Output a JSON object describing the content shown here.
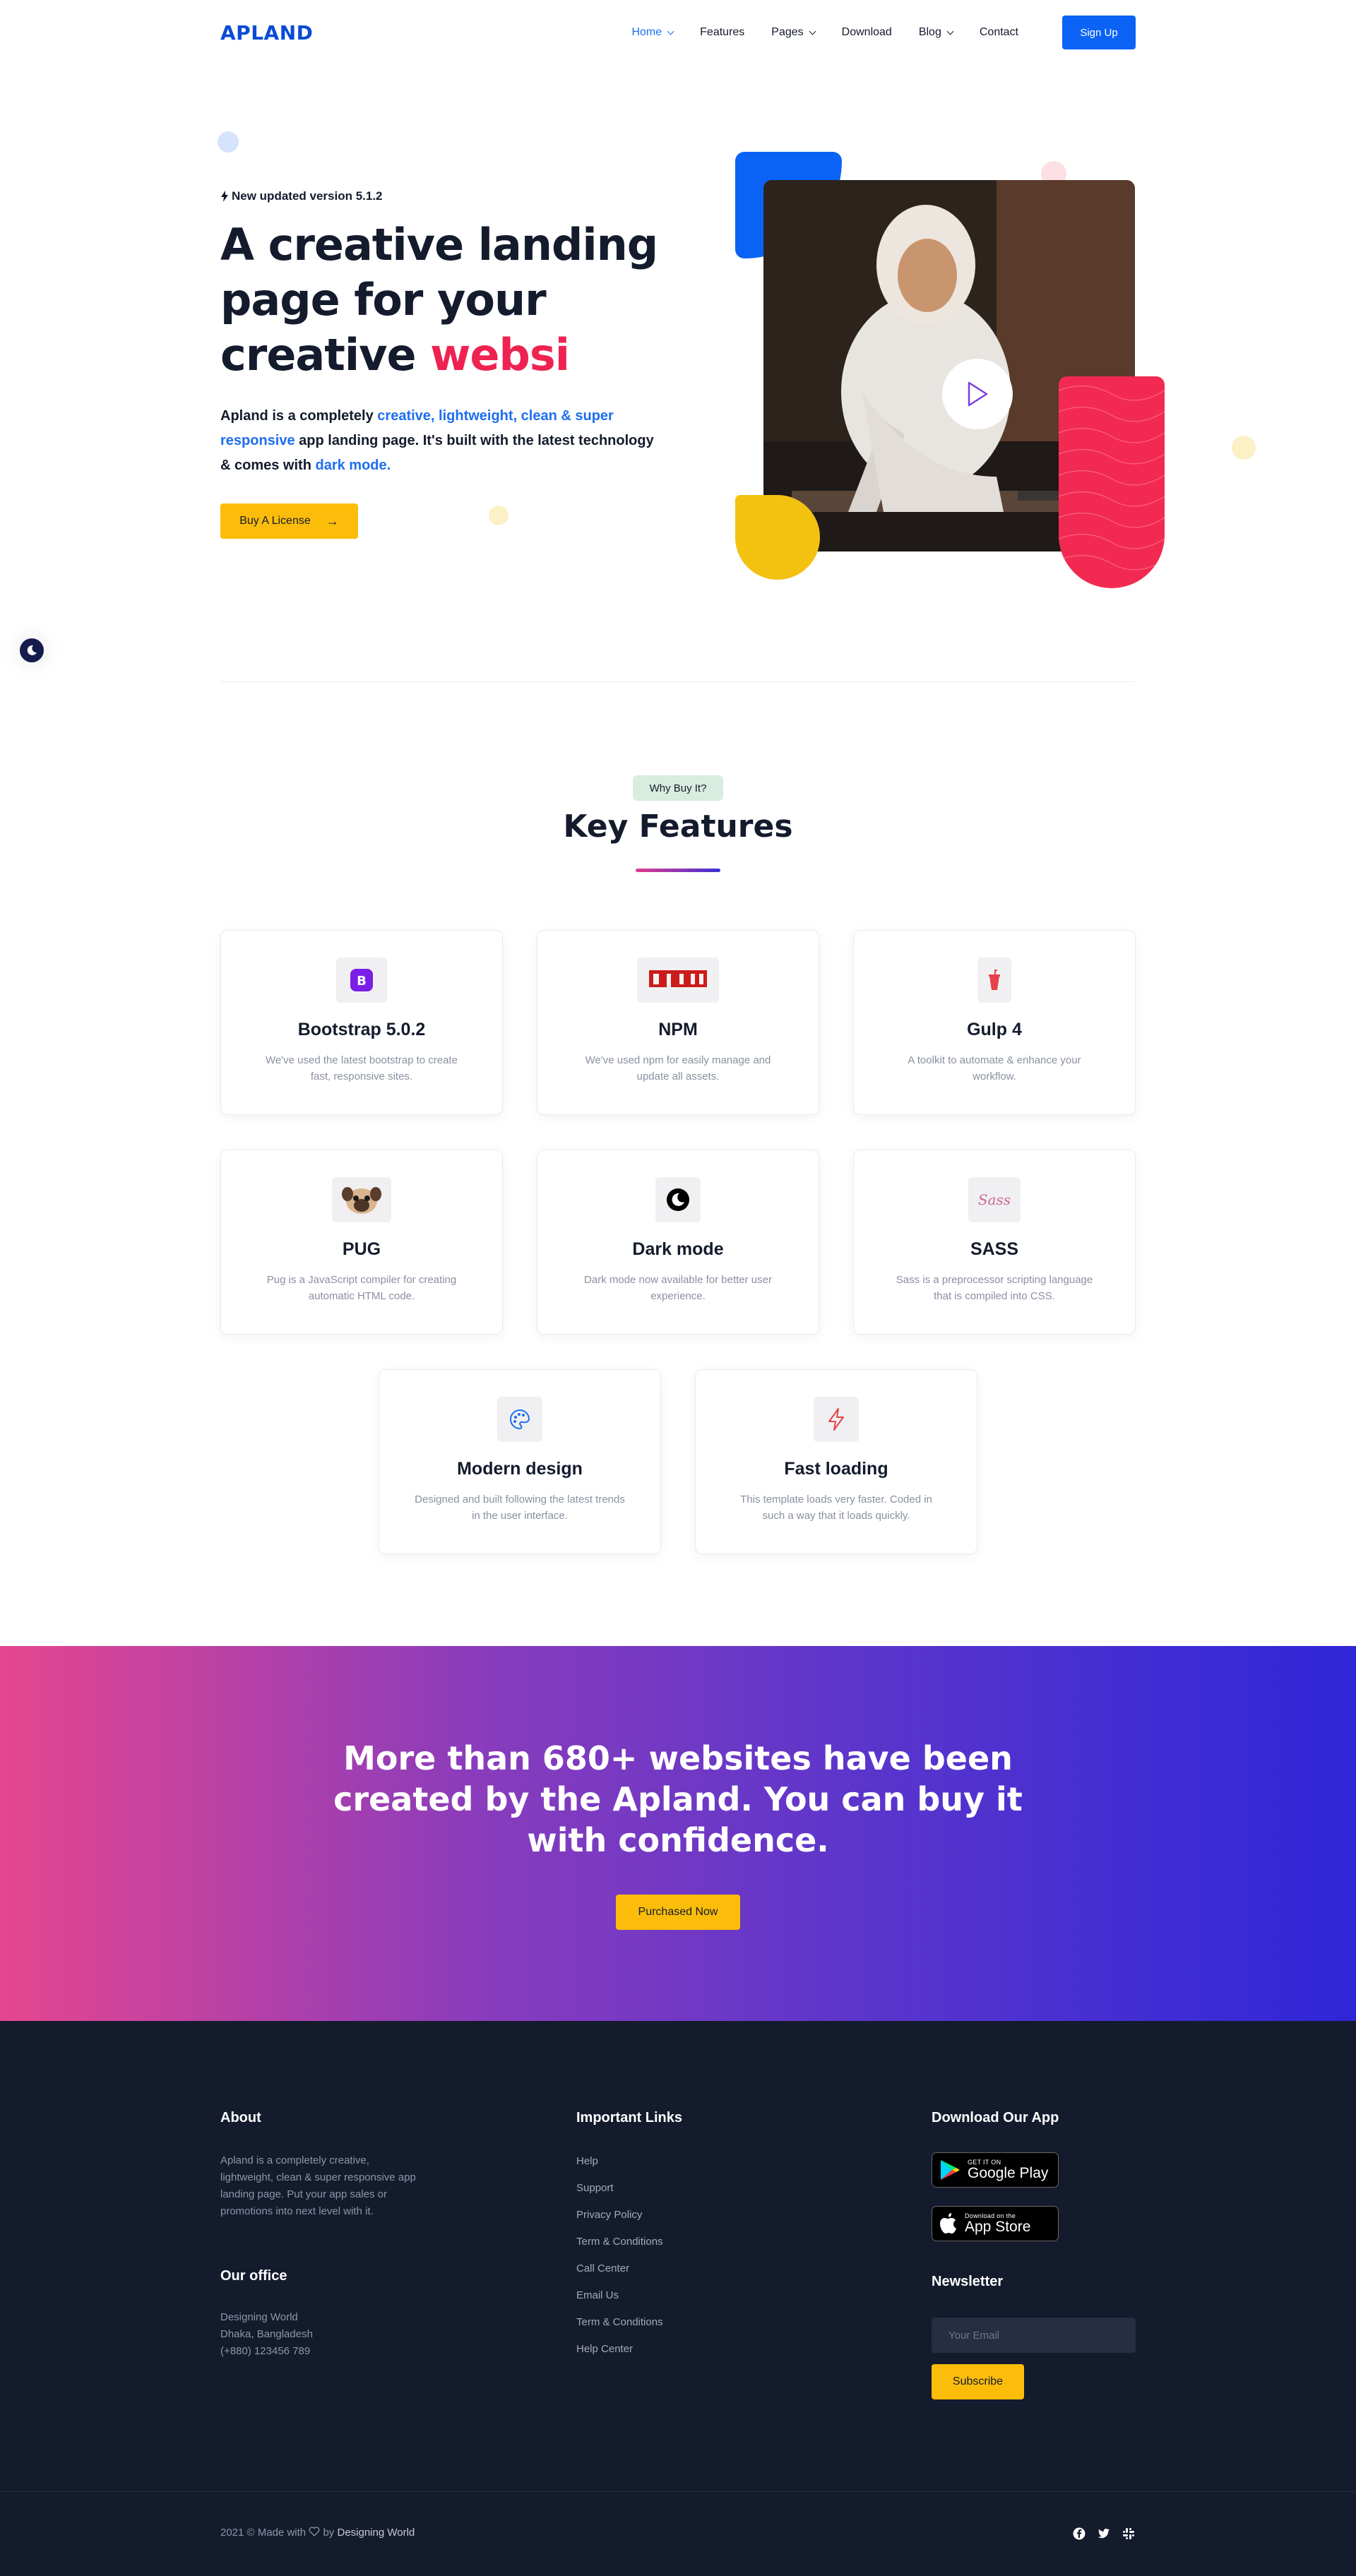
{
  "header": {
    "logo": "APLAND",
    "nav": [
      {
        "label": "Home",
        "active": true,
        "has_dropdown": true
      },
      {
        "label": "Features",
        "active": false,
        "has_dropdown": false
      },
      {
        "label": "Pages",
        "active": false,
        "has_dropdown": true
      },
      {
        "label": "Download",
        "active": false,
        "has_dropdown": false
      },
      {
        "label": "Blog",
        "active": false,
        "has_dropdown": true
      },
      {
        "label": "Contact",
        "active": false,
        "has_dropdown": false
      }
    ],
    "signup_label": "Sign Up"
  },
  "hero": {
    "version_text": "New updated version 5.1.2",
    "title_line1": "A creative landing",
    "title_line2": "page for your",
    "title_line3_prefix": "creative ",
    "title_line3_accent": "websi",
    "desc_part1": "Apland is a completely ",
    "desc_highlight1": "creative, lightweight, clean & super responsive",
    "desc_part2": " app landing page. It's built with the latest technology & comes with ",
    "desc_highlight2": "dark mode.",
    "cta_label": "Buy A License"
  },
  "features": {
    "pill": "Why Buy It?",
    "title": "Key Features",
    "cards": [
      {
        "icon": "bootstrap-icon",
        "title": "Bootstrap 5.0.2",
        "desc": "We've used the latest bootstrap to create fast, responsive sites."
      },
      {
        "icon": "npm-icon",
        "title": "NPM",
        "desc": "We've used npm for easily manage and update all assets."
      },
      {
        "icon": "gulp-icon",
        "title": "Gulp 4",
        "desc": "A toolkit to automate & enhance your workflow."
      },
      {
        "icon": "pug-icon",
        "title": "PUG",
        "desc": "Pug is a JavaScript compiler for creating automatic HTML code."
      },
      {
        "icon": "moon-icon",
        "title": "Dark mode",
        "desc": "Dark mode now available for better user experience."
      },
      {
        "icon": "sass-icon",
        "title": "SASS",
        "desc": "Sass is a preprocessor scripting language that is compiled into CSS."
      },
      {
        "icon": "palette-icon",
        "title": "Modern design",
        "desc": "Designed and built following the latest trends in the user interface."
      },
      {
        "icon": "lightning-icon",
        "title": "Fast loading",
        "desc": "This template loads very faster. Coded in such a way that it loads quickly."
      }
    ]
  },
  "cta": {
    "text": "More than 680+ websites have been created by the Apland. You can buy it with confidence.",
    "button": "Purchased Now"
  },
  "footer": {
    "about_heading": "About",
    "about_text": "Apland is a completely creative, lightweight, clean & super responsive app landing page. Put your app sales or promotions into next level with it.",
    "office_heading": "Our office",
    "office_lines": [
      "Designing World",
      "Dhaka, Bangladesh",
      "(+880) 123456 789"
    ],
    "links_heading": "Important Links",
    "links": [
      "Help",
      "Support",
      "Privacy Policy",
      "Term & Conditions",
      "Call Center",
      "Email Us",
      "Term & Conditions",
      "Help Center"
    ],
    "app_heading": "Download Our App",
    "google_small": "GET IT ON",
    "google_big": "Google Play",
    "apple_small": "Download on the",
    "apple_big": "App Store",
    "newsletter_heading": "Newsletter",
    "email_placeholder": "Your Email",
    "subscribe_label": "Subscribe",
    "copyright_prefix": "2021 © Made with ",
    "copyright_mid": " by ",
    "copyright_brand": "Designing World"
  },
  "colors": {
    "primary_blue": "#0b63f6",
    "accent_red": "#ee2351",
    "accent_yellow": "#fbbd09",
    "footer_bg": "#141b2d"
  }
}
